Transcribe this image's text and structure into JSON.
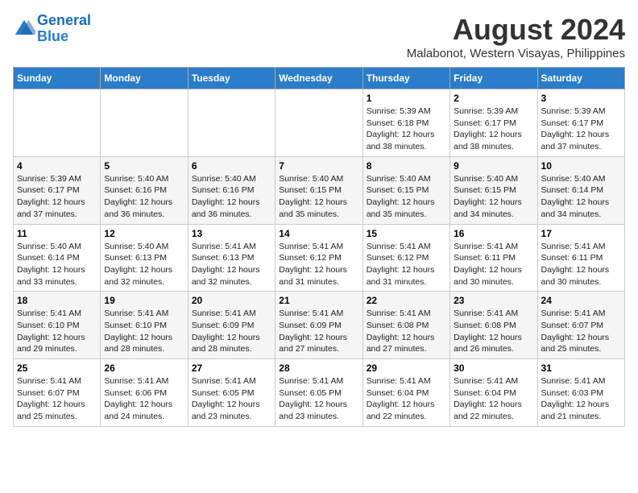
{
  "header": {
    "logo_line1": "General",
    "logo_line2": "Blue",
    "title": "August 2024",
    "subtitle": "Malabonot, Western Visayas, Philippines"
  },
  "weekdays": [
    "Sunday",
    "Monday",
    "Tuesday",
    "Wednesday",
    "Thursday",
    "Friday",
    "Saturday"
  ],
  "weeks": [
    [
      {
        "day": "",
        "content": ""
      },
      {
        "day": "",
        "content": ""
      },
      {
        "day": "",
        "content": ""
      },
      {
        "day": "",
        "content": ""
      },
      {
        "day": "1",
        "content": "Sunrise: 5:39 AM\nSunset: 6:18 PM\nDaylight: 12 hours\nand 38 minutes."
      },
      {
        "day": "2",
        "content": "Sunrise: 5:39 AM\nSunset: 6:17 PM\nDaylight: 12 hours\nand 38 minutes."
      },
      {
        "day": "3",
        "content": "Sunrise: 5:39 AM\nSunset: 6:17 PM\nDaylight: 12 hours\nand 37 minutes."
      }
    ],
    [
      {
        "day": "4",
        "content": "Sunrise: 5:39 AM\nSunset: 6:17 PM\nDaylight: 12 hours\nand 37 minutes."
      },
      {
        "day": "5",
        "content": "Sunrise: 5:40 AM\nSunset: 6:16 PM\nDaylight: 12 hours\nand 36 minutes."
      },
      {
        "day": "6",
        "content": "Sunrise: 5:40 AM\nSunset: 6:16 PM\nDaylight: 12 hours\nand 36 minutes."
      },
      {
        "day": "7",
        "content": "Sunrise: 5:40 AM\nSunset: 6:15 PM\nDaylight: 12 hours\nand 35 minutes."
      },
      {
        "day": "8",
        "content": "Sunrise: 5:40 AM\nSunset: 6:15 PM\nDaylight: 12 hours\nand 35 minutes."
      },
      {
        "day": "9",
        "content": "Sunrise: 5:40 AM\nSunset: 6:15 PM\nDaylight: 12 hours\nand 34 minutes."
      },
      {
        "day": "10",
        "content": "Sunrise: 5:40 AM\nSunset: 6:14 PM\nDaylight: 12 hours\nand 34 minutes."
      }
    ],
    [
      {
        "day": "11",
        "content": "Sunrise: 5:40 AM\nSunset: 6:14 PM\nDaylight: 12 hours\nand 33 minutes."
      },
      {
        "day": "12",
        "content": "Sunrise: 5:40 AM\nSunset: 6:13 PM\nDaylight: 12 hours\nand 32 minutes."
      },
      {
        "day": "13",
        "content": "Sunrise: 5:41 AM\nSunset: 6:13 PM\nDaylight: 12 hours\nand 32 minutes."
      },
      {
        "day": "14",
        "content": "Sunrise: 5:41 AM\nSunset: 6:12 PM\nDaylight: 12 hours\nand 31 minutes."
      },
      {
        "day": "15",
        "content": "Sunrise: 5:41 AM\nSunset: 6:12 PM\nDaylight: 12 hours\nand 31 minutes."
      },
      {
        "day": "16",
        "content": "Sunrise: 5:41 AM\nSunset: 6:11 PM\nDaylight: 12 hours\nand 30 minutes."
      },
      {
        "day": "17",
        "content": "Sunrise: 5:41 AM\nSunset: 6:11 PM\nDaylight: 12 hours\nand 30 minutes."
      }
    ],
    [
      {
        "day": "18",
        "content": "Sunrise: 5:41 AM\nSunset: 6:10 PM\nDaylight: 12 hours\nand 29 minutes."
      },
      {
        "day": "19",
        "content": "Sunrise: 5:41 AM\nSunset: 6:10 PM\nDaylight: 12 hours\nand 28 minutes."
      },
      {
        "day": "20",
        "content": "Sunrise: 5:41 AM\nSunset: 6:09 PM\nDaylight: 12 hours\nand 28 minutes."
      },
      {
        "day": "21",
        "content": "Sunrise: 5:41 AM\nSunset: 6:09 PM\nDaylight: 12 hours\nand 27 minutes."
      },
      {
        "day": "22",
        "content": "Sunrise: 5:41 AM\nSunset: 6:08 PM\nDaylight: 12 hours\nand 27 minutes."
      },
      {
        "day": "23",
        "content": "Sunrise: 5:41 AM\nSunset: 6:08 PM\nDaylight: 12 hours\nand 26 minutes."
      },
      {
        "day": "24",
        "content": "Sunrise: 5:41 AM\nSunset: 6:07 PM\nDaylight: 12 hours\nand 25 minutes."
      }
    ],
    [
      {
        "day": "25",
        "content": "Sunrise: 5:41 AM\nSunset: 6:07 PM\nDaylight: 12 hours\nand 25 minutes."
      },
      {
        "day": "26",
        "content": "Sunrise: 5:41 AM\nSunset: 6:06 PM\nDaylight: 12 hours\nand 24 minutes."
      },
      {
        "day": "27",
        "content": "Sunrise: 5:41 AM\nSunset: 6:05 PM\nDaylight: 12 hours\nand 23 minutes."
      },
      {
        "day": "28",
        "content": "Sunrise: 5:41 AM\nSunset: 6:05 PM\nDaylight: 12 hours\nand 23 minutes."
      },
      {
        "day": "29",
        "content": "Sunrise: 5:41 AM\nSunset: 6:04 PM\nDaylight: 12 hours\nand 22 minutes."
      },
      {
        "day": "30",
        "content": "Sunrise: 5:41 AM\nSunset: 6:04 PM\nDaylight: 12 hours\nand 22 minutes."
      },
      {
        "day": "31",
        "content": "Sunrise: 5:41 AM\nSunset: 6:03 PM\nDaylight: 12 hours\nand 21 minutes."
      }
    ]
  ]
}
